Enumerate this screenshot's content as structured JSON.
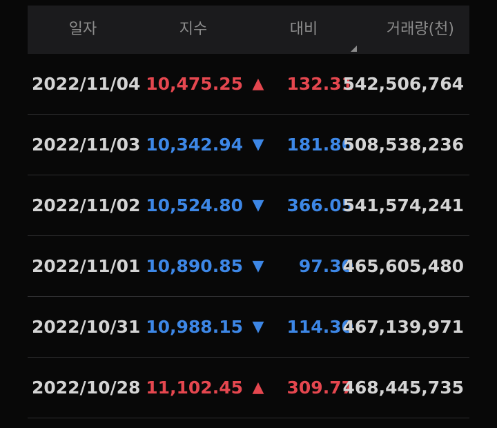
{
  "header": {
    "date": "일자",
    "index": "지수",
    "change": "대비",
    "volume": "거래량(천)"
  },
  "colors": {
    "up": "#e5474f",
    "down": "#3d87e6",
    "background": "#080808",
    "header_bg": "#1b1b1d"
  },
  "rows": [
    {
      "date": "2022/11/04",
      "index": "10,475.25",
      "arrow": "▲",
      "direction": "up",
      "change": "132.31",
      "volume": "542,506,764"
    },
    {
      "date": "2022/11/03",
      "index": "10,342.94",
      "arrow": "▼",
      "direction": "down",
      "change": "181.86",
      "volume": "508,538,236"
    },
    {
      "date": "2022/11/02",
      "index": "10,524.80",
      "arrow": "▼",
      "direction": "down",
      "change": "366.05",
      "volume": "541,574,241"
    },
    {
      "date": "2022/11/01",
      "index": "10,890.85",
      "arrow": "▼",
      "direction": "down",
      "change": "97.30",
      "volume": "465,605,480"
    },
    {
      "date": "2022/10/31",
      "index": "10,988.15",
      "arrow": "▼",
      "direction": "down",
      "change": "114.30",
      "volume": "467,139,971"
    },
    {
      "date": "2022/10/28",
      "index": "11,102.45",
      "arrow": "▲",
      "direction": "up",
      "change": "309.77",
      "volume": "468,445,735"
    }
  ]
}
